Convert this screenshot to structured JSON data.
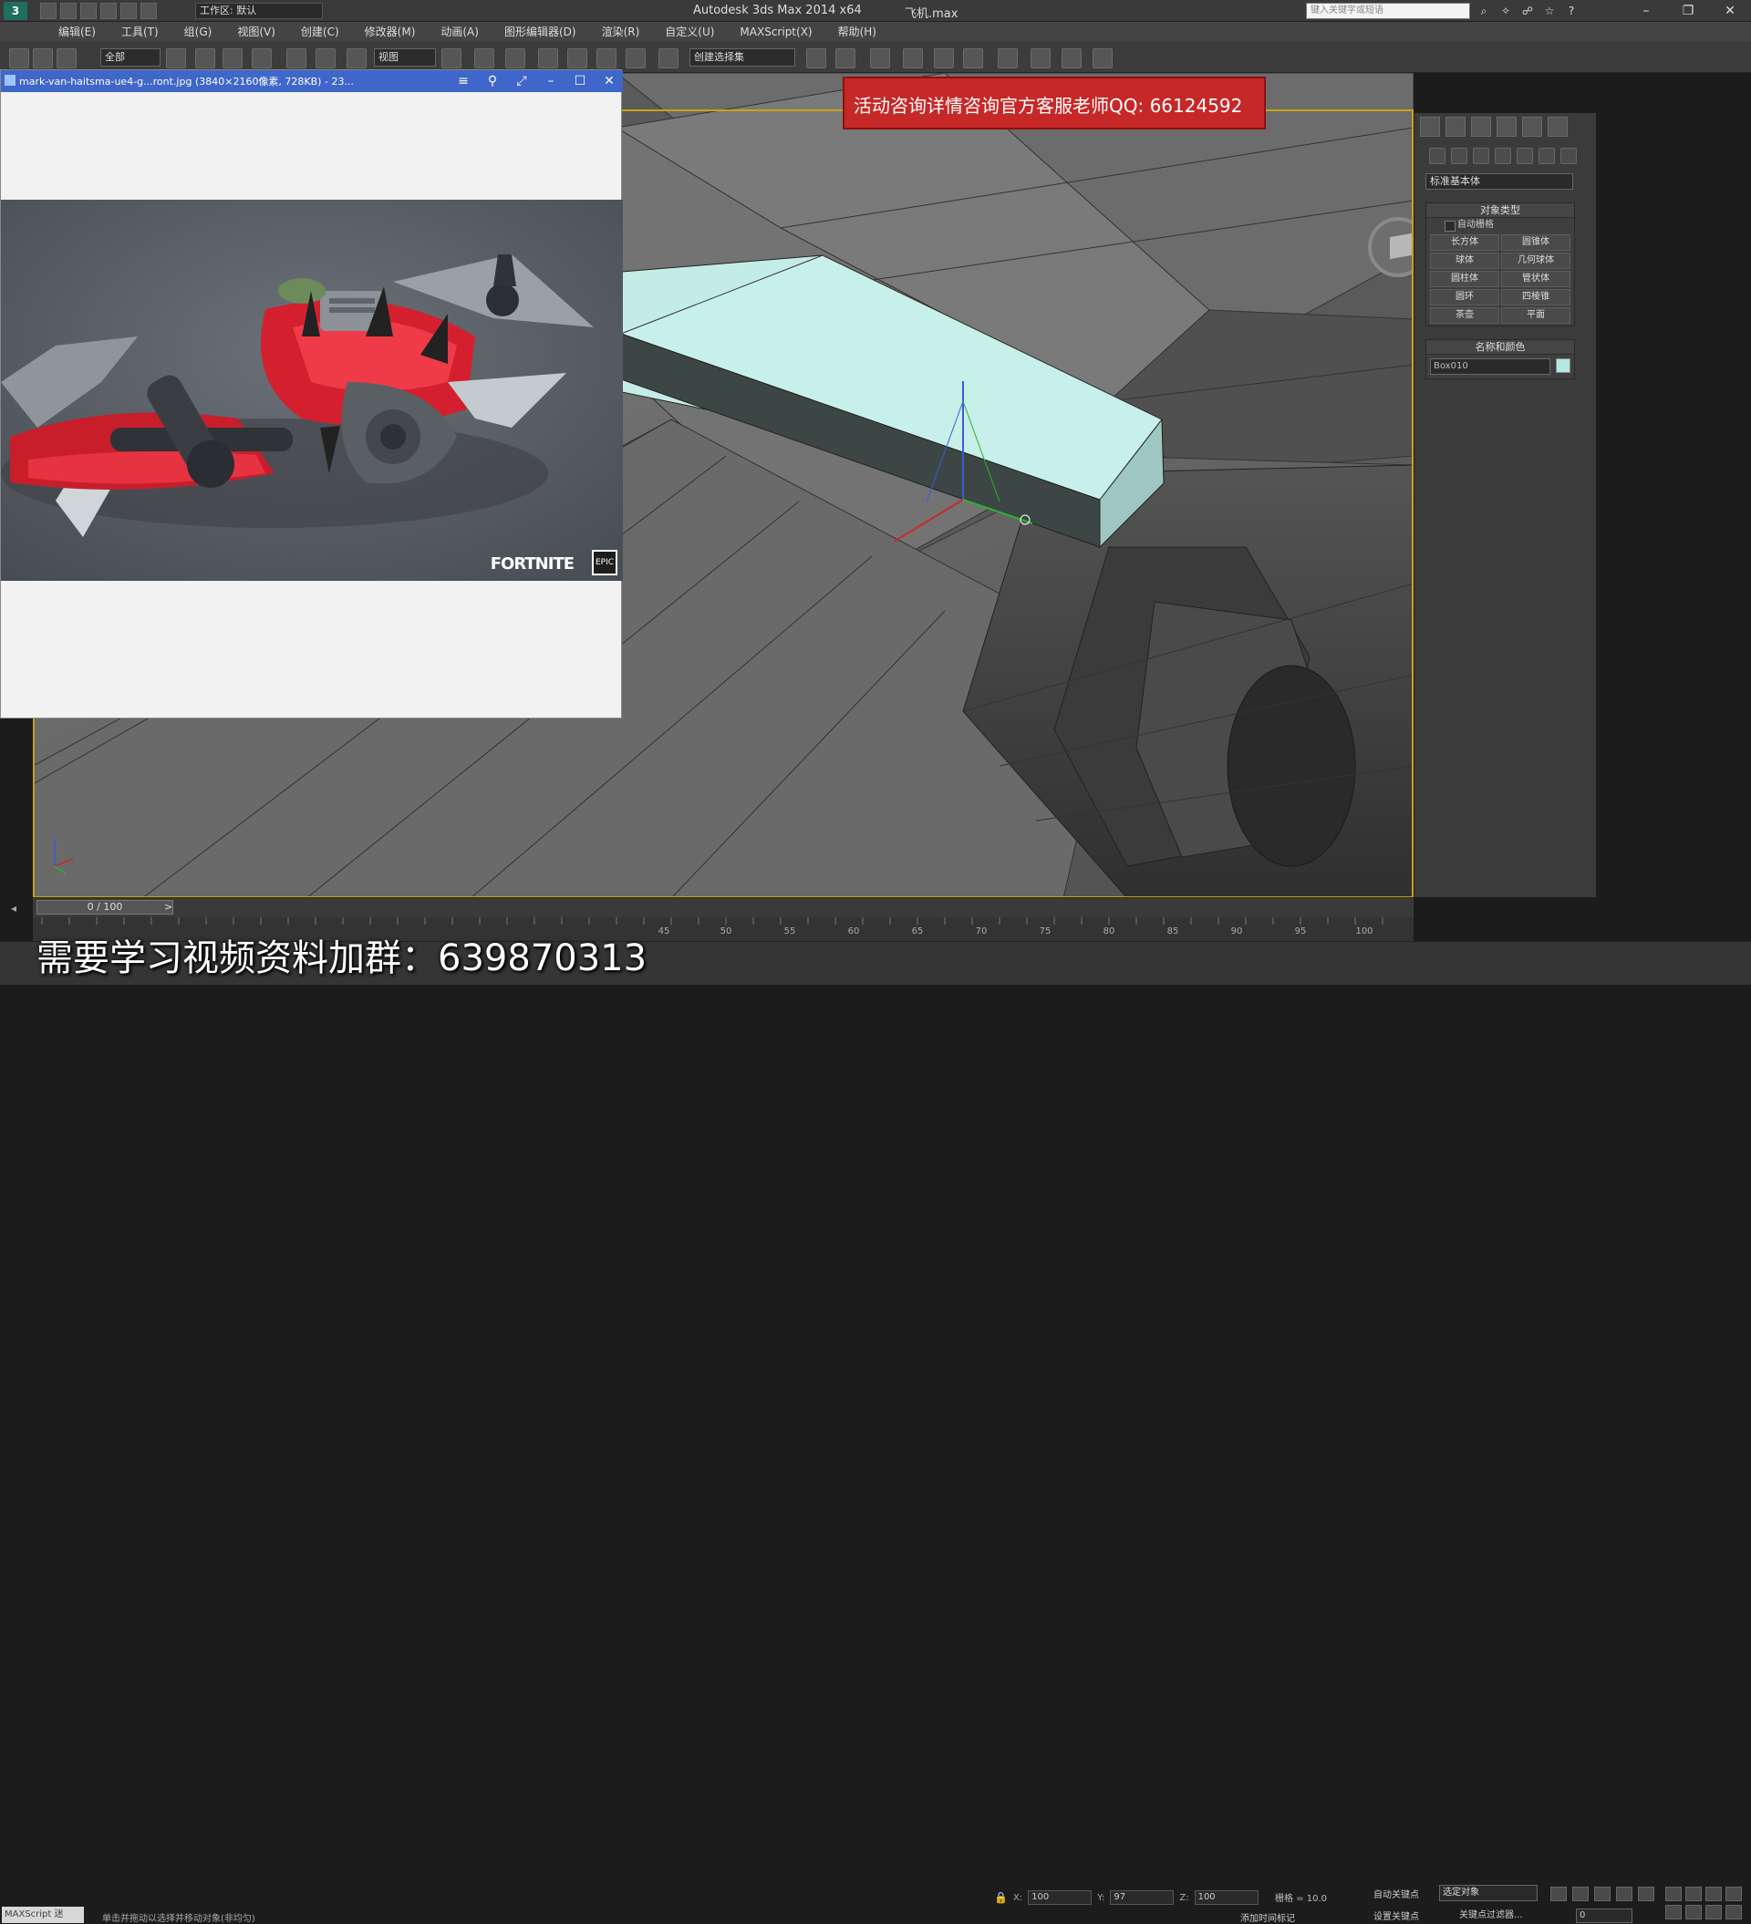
{
  "window": {
    "app_title": "Autodesk 3ds Max  2014 x64",
    "file_title": "飞机.max",
    "workspace": "工作区: 默认",
    "search_placeholder": "键入关键字或短语"
  },
  "menu": [
    "编辑(E)",
    "工具(T)",
    "组(G)",
    "视图(V)",
    "创建(C)",
    "修改器(M)",
    "动画(A)",
    "图形编辑器(D)",
    "渲染(R)",
    "自定义(U)",
    "MAXScript(X)",
    "帮助(H)"
  ],
  "toolbar": {
    "selection_filter": "全部",
    "ref_coord": "视图",
    "named_selection": "创建选择集"
  },
  "ad_banner": "活动咨询详情咨询官方客服老师QQ: 66124592",
  "image_viewer": {
    "title": "mark-van-haitsma-ue4-g...ront.jpg  (3840×2160像素, 728KB) - 23...",
    "brand": "FORTNITE",
    "epic": "EPIC"
  },
  "command_panel": {
    "category": "标准基本体",
    "object_type_header": "对象类型",
    "autogrid": "自动栅格",
    "objects": [
      "长方体",
      "圆锥体",
      "球体",
      "几何球体",
      "圆柱体",
      "管状体",
      "圆环",
      "四棱锥",
      "茶壶",
      "平面"
    ],
    "name_color_header": "名称和颜色",
    "object_name": "Box010",
    "object_color": "#b4e8e0"
  },
  "timeline": {
    "frame_display": "0 / 100",
    "ticks": [
      "45",
      "50",
      "55",
      "60",
      "65",
      "70",
      "75",
      "80",
      "85",
      "90",
      "95",
      "100"
    ]
  },
  "status": {
    "watermark": "需要学习视频资料加群：639870313",
    "maxscript": "MAXScript 迷",
    "prompt": "单击并拖动以选择并移动对象(非均匀)",
    "x_label": "X:",
    "x_value": "100",
    "y_label": "Y:",
    "y_value": "97",
    "z_label": "Z:",
    "z_value": "100",
    "grid": "栅格 = 10.0",
    "add_time_tag": "添加时间标记",
    "auto_key": "自动关键点",
    "set_key": "设置关键点",
    "key_mode": "选定对象",
    "key_filters": "关键点过滤器...",
    "current_frame": "0"
  }
}
